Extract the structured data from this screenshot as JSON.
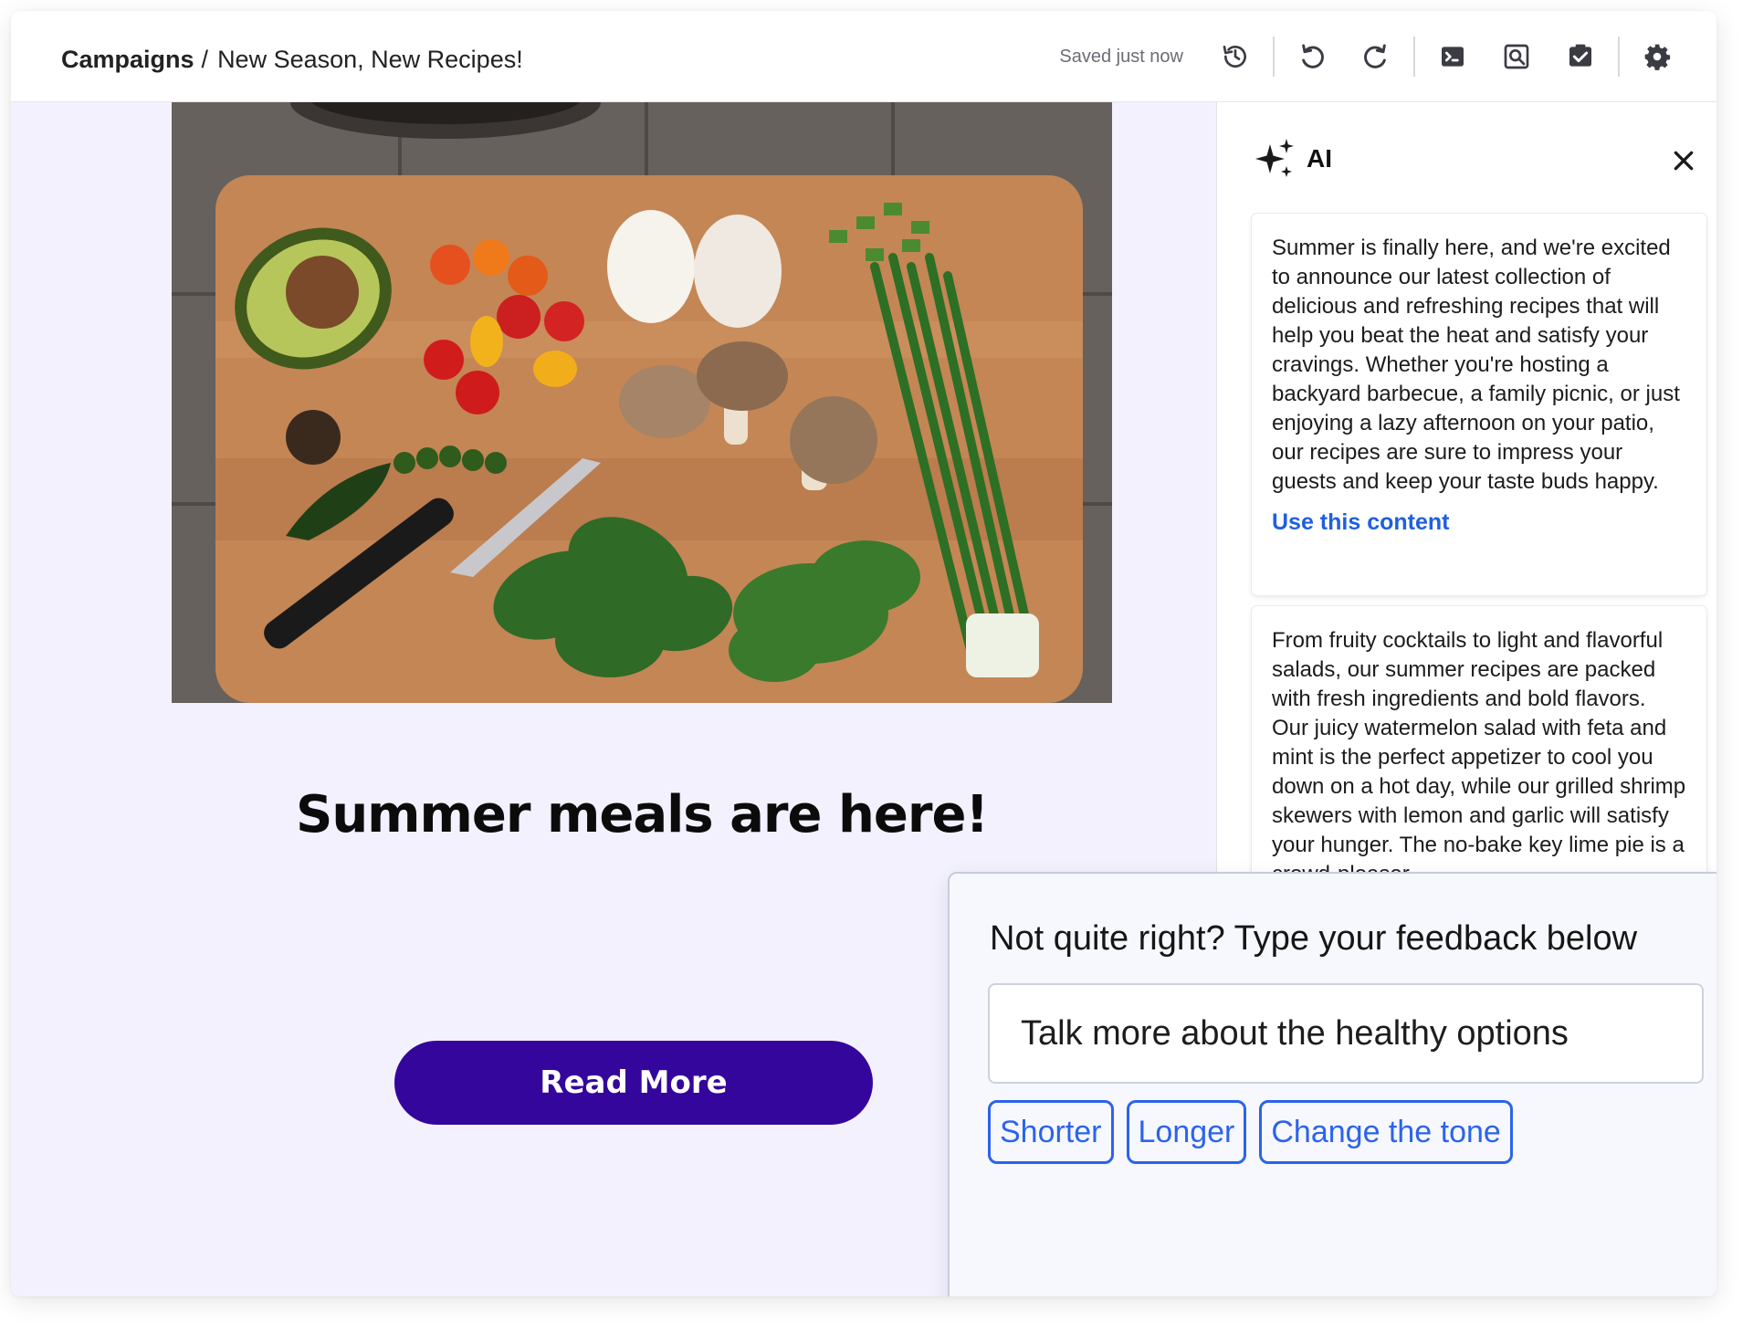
{
  "header": {
    "breadcrumb_root": "Campaigns",
    "breadcrumb_separator": "/",
    "breadcrumb_current": "New Season, New Recipes!",
    "saved_status": "Saved just now",
    "tools": [
      {
        "icon": "history-icon"
      },
      {
        "icon": "undo-icon"
      },
      {
        "icon": "redo-icon"
      },
      {
        "icon": "code-icon"
      },
      {
        "icon": "preview-icon"
      },
      {
        "icon": "checklist-icon"
      },
      {
        "icon": "gear-icon"
      }
    ]
  },
  "canvas": {
    "image_subject": "Cutting board with avocado, tomatoes, eggs, mushrooms, spinach, green onions and a knife",
    "headline": "Summer meals are here!",
    "button_label": "Read More",
    "button_color": "#34069c",
    "background_color": "#f4f1fe"
  },
  "ai_panel": {
    "title": "AI",
    "suggestions": [
      {
        "text": "Summer is finally here, and we're excited to announce our latest collection of delicious and refreshing recipes that will help you beat the heat and satisfy your cravings. Whether you're hosting a backyard barbecue, a family picnic, or just enjoying a lazy afternoon on your patio, our recipes are sure to impress your guests and keep your taste buds happy.",
        "action": "Use this content"
      },
      {
        "text": "From fruity cocktails to light and flavorful salads, our summer recipes are packed with fresh ingredients and bold flavors. Our juicy watermelon salad with feta and mint is the perfect appetizer to cool you down on a hot day, while our grilled shrimp skewers with lemon and garlic will satisfy your hunger. The no-bake key lime pie is a crowd-pleaser"
      }
    ],
    "link_color": "#1f5fe0"
  },
  "feedback": {
    "title": "Not quite right? Type your feedback below",
    "input_value": "Talk more about the healthy options",
    "chips": [
      "Shorter",
      "Longer",
      "Change the tone"
    ],
    "chip_color": "#2b63ec"
  }
}
